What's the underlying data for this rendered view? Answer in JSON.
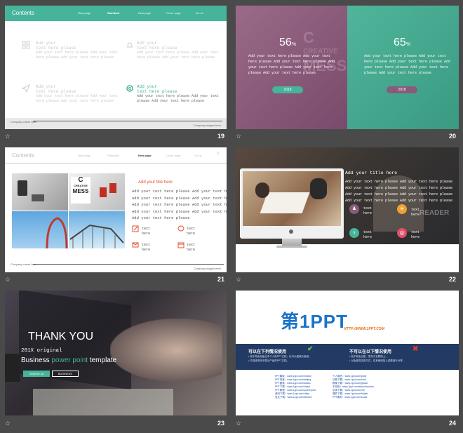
{
  "slides": {
    "s19": {
      "number": "19",
      "header_title": "Contents",
      "nav": [
        "Next page",
        "Standard",
        "New page",
        "Cover page",
        "Go on"
      ],
      "items": [
        {
          "title": "Add your",
          "line1": "text here please",
          "body1": "Add your text here please Add your text",
          "body2": "here please Add your text here please"
        },
        {
          "title": "Add your",
          "line1": "text here please",
          "body1": "Add your text here please Add your text",
          "body2": "here please Add your text here please"
        },
        {
          "title": "Add your",
          "line1": "text here please",
          "body1": "Add your text here please Add your text",
          "body2": "here please Add your text here please"
        },
        {
          "title": "Add your",
          "line1": "text here please",
          "body1": "Add your text here please Add your text",
          "body2": "please Add your text here please"
        }
      ],
      "footer_left": "Company name here",
      "footer_right": "Company slogan here"
    },
    "s20": {
      "number": "20",
      "left": {
        "percent": "56",
        "unit": "%",
        "lines": [
          "Add your text here please Add your text",
          "here please Add your text here please Add",
          "your text here please Add your text here",
          "please Add your text here please"
        ],
        "button": "2018"
      },
      "right": {
        "percent": "65",
        "unit": "%",
        "lines": [
          "Add your text here please Add your text",
          "here please Add your text here please Add",
          "your text here please Add your text here",
          "please Add your text here please"
        ],
        "button": "2018"
      },
      "bg_text": [
        "C",
        "CREATIVE",
        "MESS"
      ]
    },
    "s21": {
      "number": "21",
      "header_title": "Contents",
      "nav": [
        "Next page",
        "Standard",
        "New page",
        "Cover page",
        "Go on"
      ],
      "title": "Add your title here",
      "lines": [
        "Add your text here please Add your text here",
        "Add your text here please Add your text here",
        "Add your text here please Add your text here",
        "Add your text here please Add your text here",
        "Add your text here please"
      ],
      "icons": [
        {
          "l1": "text",
          "l2": "here"
        },
        {
          "l1": "text",
          "l2": "here"
        },
        {
          "l1": "text",
          "l2": "here"
        },
        {
          "l1": "text",
          "l2": "here"
        }
      ],
      "photo_text": [
        "C",
        "CREATIVE",
        "MESS"
      ],
      "footer_left": "Company name here",
      "footer_right": "Company slogan here"
    },
    "s22": {
      "number": "22",
      "title": "Add your title here",
      "lines": [
        "Add your text here please Add your text here please",
        "Add your text here please Add your text here please",
        "Add your text here please Add your text here please",
        "Add your text here please Add your text here please"
      ],
      "icons": [
        {
          "l1": "text",
          "l2": "here"
        },
        {
          "l1": "text",
          "l2": "here"
        },
        {
          "l1": "text",
          "l2": "here"
        },
        {
          "l1": "text",
          "l2": "here"
        }
      ],
      "bg_text": "READER"
    },
    "s23": {
      "number": "23",
      "heading": "THANK YOU",
      "subtitle": "201X original",
      "tagline_pre": "Business",
      "tagline_accent": "power point",
      "tagline_post": "template",
      "btn1": "2018.05.18",
      "btn2": "BUSINESS"
    },
    "s24": {
      "number": "24",
      "logo_main": "第1PPT",
      "logo_url": "HTTP://WWW.1PPT.COM",
      "can_title": "可以在下列情况使用",
      "can_lines": [
        "• 用于商业用途当中个人的PPT文档，也可以做演示使用。",
        "• 内容修改用于展示产品的PPT文档。"
      ],
      "cannot_title": "不可以在以下情况使用",
      "cannot_lines": [
        "• 用于商业出售，发布于互联网上。",
        "• 以免费供应的方式，在其他网站上或是进行分享。"
      ],
      "links_col1": [
        "PPT模板：www.1ppt.com/moban",
        "PPT背景：www.1ppt.com/beijing",
        "PPT图表：www.1ppt.com/tubiao",
        "PPT下载：www.1ppt.com/xiazai",
        "PPT教程：www.1ppt.com/powerpoint",
        "资料下载：www.1ppt.com/ziliao",
        "范文下载：www.1ppt.com/fanwen"
      ],
      "links_col2": [
        "个人简历：www.1ppt.com/jianli",
        "试卷下载：www.1ppt.com/shiti",
        "教案下载：www.1ppt.com/jiaoan",
        "手抄报：www.1ppt.com/shouchaobao",
        "字体下载：www.1ppt.com/ziti",
        "课件下载：www.1ppt.com/kejian",
        "PPT素材：www.1ppt.com/sucai"
      ]
    }
  },
  "star_icon": "star-icon",
  "colors": {
    "teal": "#3aa58c",
    "purple": "#8a5a7a",
    "navy": "#233a64",
    "orange": "#e8701a",
    "blue": "#1a73c9"
  }
}
